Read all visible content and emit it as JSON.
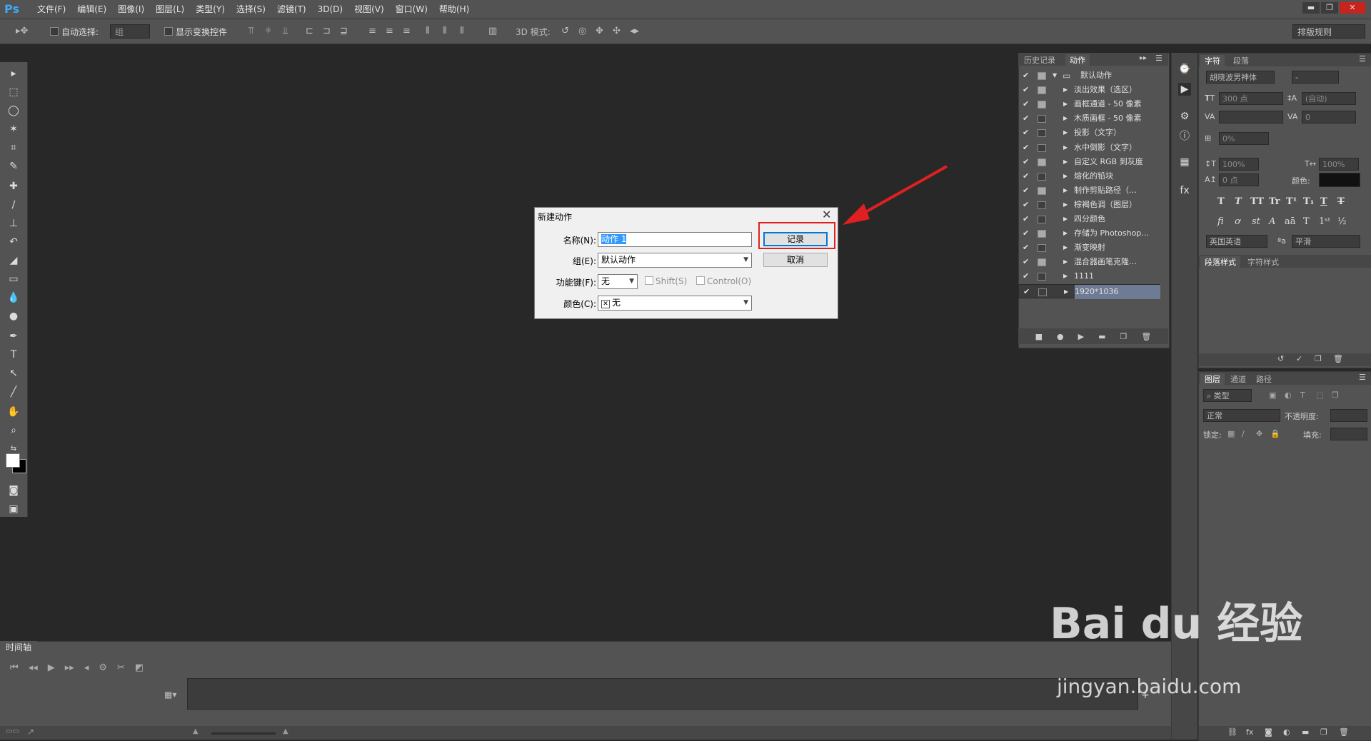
{
  "app": {
    "logo": "Ps"
  },
  "menu": [
    "文件(F)",
    "编辑(E)",
    "图像(I)",
    "图层(L)",
    "类型(Y)",
    "选择(S)",
    "滤镜(T)",
    "3D(D)",
    "视图(V)",
    "窗口(W)",
    "帮助(H)"
  ],
  "window_controls": {
    "minimize": "▬",
    "restore": "❐",
    "close": "✕"
  },
  "options_bar": {
    "auto_select_label": "自动选择:",
    "auto_select_value": "组",
    "show_transform_label": "显示变换控件",
    "mode_3d_label": "3D 模式:",
    "workspace": "排版规则"
  },
  "timeline": {
    "tab": "时间轴"
  },
  "actions_panel": {
    "tabs": [
      "历史记录",
      "动作"
    ],
    "set_name": "默认动作",
    "items": [
      {
        "name": "淡出效果（选区）",
        "dialog": true
      },
      {
        "name": "画框通道 - 50 像素",
        "dialog": true
      },
      {
        "name": "木质画框 - 50 像素",
        "dialog": false
      },
      {
        "name": "投影（文字）",
        "dialog": false
      },
      {
        "name": "水中倒影（文字）",
        "dialog": false
      },
      {
        "name": "自定义 RGB 到灰度",
        "dialog": true
      },
      {
        "name": "熔化的铅块",
        "dialog": false
      },
      {
        "name": "制作剪贴路径（…",
        "dialog": true
      },
      {
        "name": "棕褐色调（图层）",
        "dialog": false
      },
      {
        "name": "四分颜色",
        "dialog": false
      },
      {
        "name": "存储为 Photoshop…",
        "dialog": true
      },
      {
        "name": "渐变映射",
        "dialog": false
      },
      {
        "name": "混合器画笔克隆…",
        "dialog": true
      },
      {
        "name": "1111",
        "dialog": false
      },
      {
        "name": "1920*1036",
        "dialog": false,
        "selected": true
      }
    ]
  },
  "character_panel": {
    "tabs": [
      "字符",
      "段落"
    ],
    "font": "胡晓波男神体",
    "style": "-",
    "size": "300 点",
    "leading": "(自动)",
    "tracking": "0",
    "scale": "0%",
    "vscale": "100%",
    "hscale": "100%",
    "baseline": "0 点",
    "color_label": "颜色:",
    "language": "英国英语",
    "aa_label": "ªa",
    "aa_value": "平滑",
    "styles_tabs": [
      "段落样式",
      "字符样式"
    ]
  },
  "layers_panel": {
    "tabs": [
      "图层",
      "通道",
      "路径"
    ],
    "filter": "类型",
    "blend": "正常",
    "opacity_label": "不透明度:",
    "lock_label": "锁定:",
    "fill_label": "填充:"
  },
  "dialog": {
    "title": "新建动作",
    "name_label": "名称(N):",
    "name_value": "动作 1",
    "set_label": "组(E):",
    "set_value": "默认动作",
    "fkey_label": "功能键(F):",
    "fkey_value": "无",
    "shift_label": "Shift(S)",
    "control_label": "Control(O)",
    "color_label": "颜色(C):",
    "color_value": "无",
    "record_button": "记录",
    "cancel_button": "取消"
  },
  "watermark": {
    "brand": "Bai du 经验",
    "url": "jingyan.baidu.com"
  }
}
